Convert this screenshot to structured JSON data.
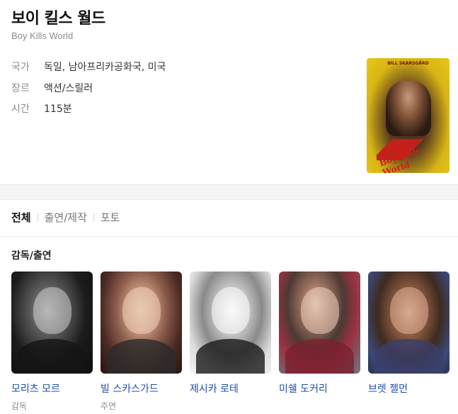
{
  "movie": {
    "title": "보이 킬스 월드",
    "subtitle": "Boy Kills World",
    "info": [
      {
        "label": "국가",
        "value": "독일, 남아프리카공화국, 미국"
      },
      {
        "label": "장르",
        "value": "액션/스릴러"
      },
      {
        "label": "시간",
        "value": "115분"
      }
    ],
    "poster": {
      "top_text": "BILL SKARSGÅRD",
      "title_text": "Boy Kills World"
    }
  },
  "tabs": [
    {
      "label": "전체",
      "active": true
    },
    {
      "label": "출연/제작",
      "active": false
    },
    {
      "label": "포토",
      "active": false
    }
  ],
  "cast_section": {
    "title": "감독/출연",
    "people": [
      {
        "name": "모리츠 모르",
        "role": "감독"
      },
      {
        "name": "빌 스카스가드",
        "role": "주연"
      },
      {
        "name": "제시카 로테",
        "role": ""
      },
      {
        "name": "미쉘 도커리",
        "role": ""
      },
      {
        "name": "브렛 젤먼",
        "role": ""
      }
    ]
  },
  "colors": {
    "link": "#1f4ea8",
    "muted": "#8c8c8c",
    "poster_yellow": "#e8c719"
  }
}
